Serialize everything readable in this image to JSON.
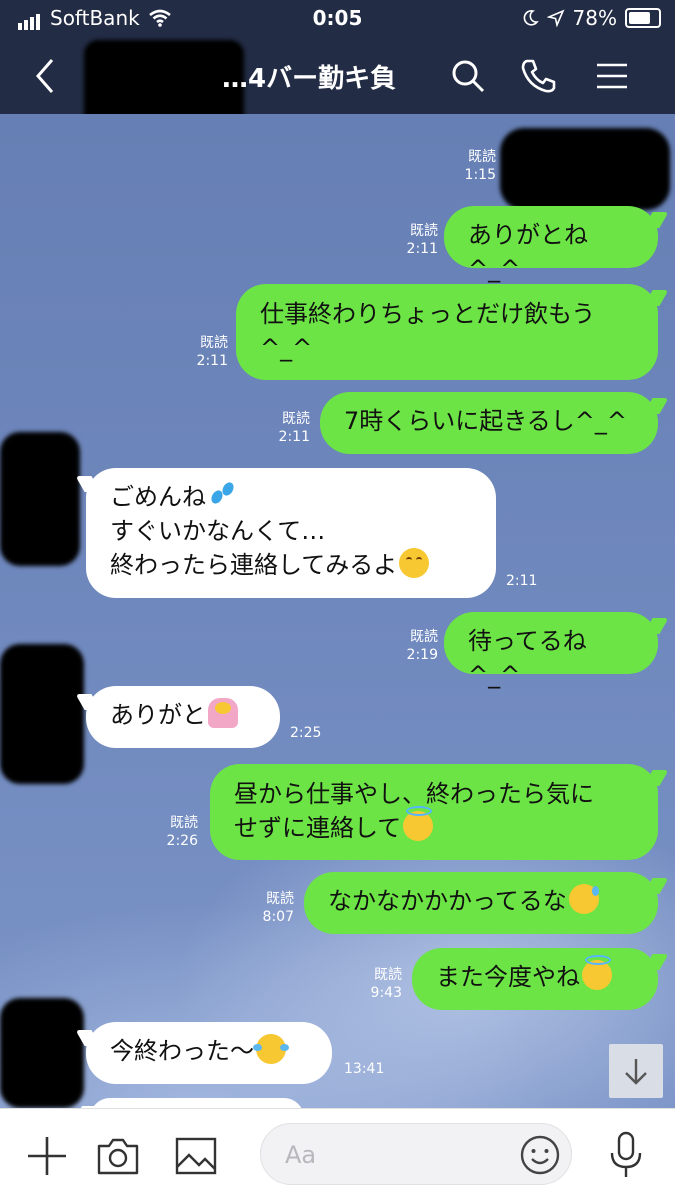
{
  "status_bar": {
    "carrier": "SoftBank",
    "time": "0:05",
    "battery": "78%",
    "battery_level": 0.78
  },
  "header": {
    "title": "…4バー勤キ負",
    "back_icon": "chevron-left-icon",
    "search_icon": "search-icon",
    "call_icon": "phone-icon",
    "menu_icon": "hamburger-menu-icon"
  },
  "chat": {
    "messages": [
      {
        "from": "me",
        "read": "既読",
        "time": "1:15",
        "text": ""
      },
      {
        "from": "me",
        "read": "既読",
        "time": "2:11",
        "text": "ありがとね^_^"
      },
      {
        "from": "me",
        "read": "既読",
        "time": "2:11",
        "line1": "仕事終わりちょっとだけ飲もう",
        "line2": "^_^"
      },
      {
        "from": "me",
        "read": "既読",
        "time": "2:11",
        "text": "7時くらいに起きるし^_^"
      },
      {
        "from": "them",
        "time": "2:11",
        "line1": "ごめんね",
        "line2": "すぐいかなんくて…",
        "line3": "終わったら連絡してみるよ",
        "emoji1": "sweat-droplets",
        "emoji3": "smiling-face"
      },
      {
        "from": "me",
        "read": "既読",
        "time": "2:19",
        "text": "待ってるね^_^"
      },
      {
        "from": "them",
        "time": "2:25",
        "text": "ありがと",
        "emoji": "person-bowing"
      },
      {
        "from": "me",
        "read": "既読",
        "time": "2:26",
        "line1": "昼から仕事やし、終わったら気に",
        "line2": "せずに連絡して",
        "emoji": "smiling-face-with-halo"
      },
      {
        "from": "me",
        "read": "既読",
        "time": "8:07",
        "text": "なかなかかかってるな",
        "emoji": "grinning-face-with-sweat"
      },
      {
        "from": "me",
        "read": "既読",
        "time": "9:43",
        "text": "また今度やね",
        "emoji": "smiling-face-with-halo"
      },
      {
        "from": "them",
        "time": "13:41",
        "text": "今終わった〜",
        "emoji": "face-with-tears-of-joy"
      }
    ]
  },
  "input_bar": {
    "placeholder": "Aa",
    "icons": [
      "plus-icon",
      "camera-icon",
      "image-icon",
      "emoji-icon",
      "microphone-icon"
    ]
  },
  "scroll_button_icon": "arrow-down-icon"
}
